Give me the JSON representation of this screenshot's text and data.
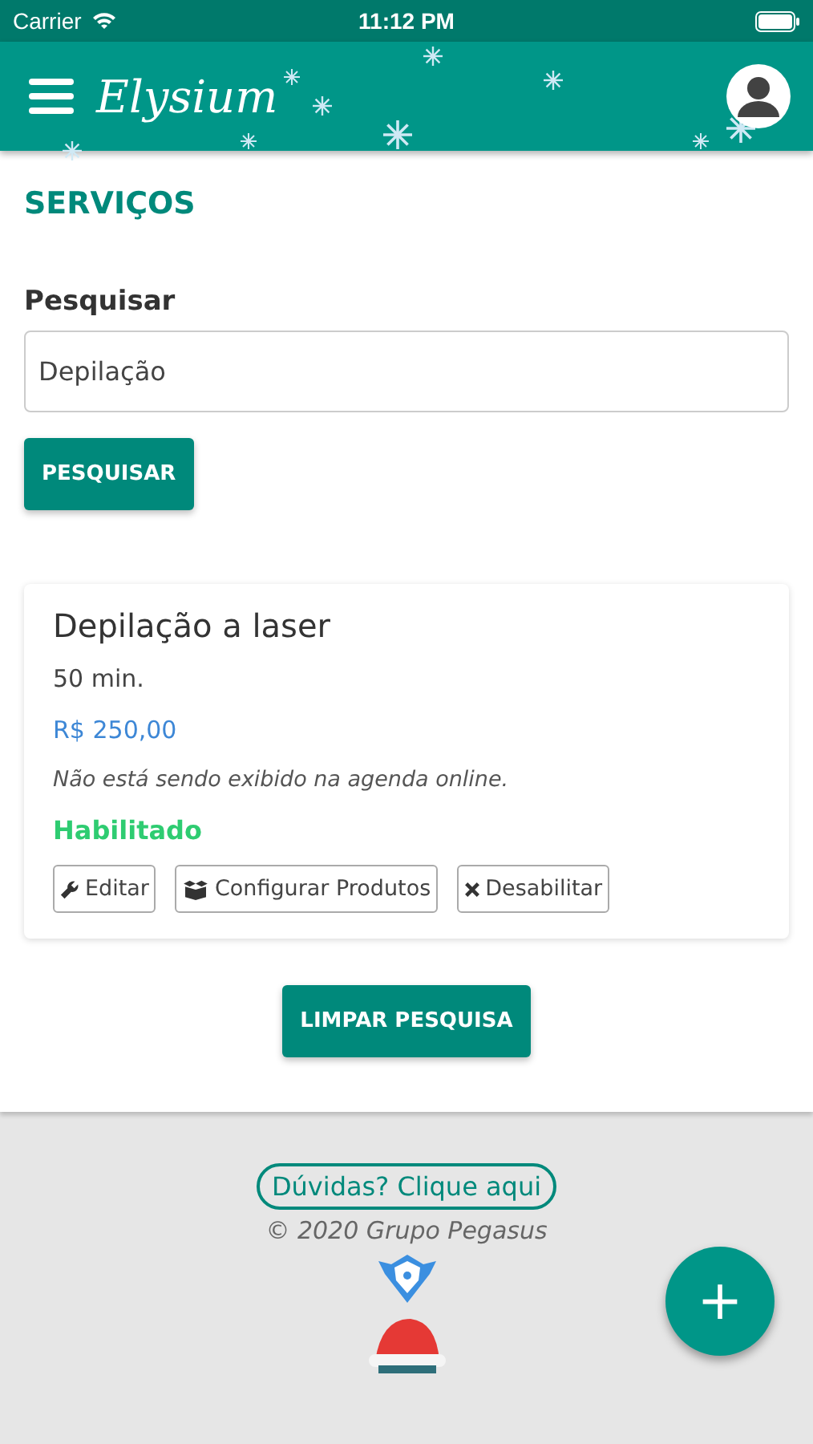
{
  "status_bar": {
    "carrier": "Carrier",
    "time": "11:12 PM"
  },
  "app_bar": {
    "title": "Elysium"
  },
  "page_title": "SERVIÇOS",
  "search": {
    "label": "Pesquisar",
    "value": "Depilação",
    "button": "PESQUISAR"
  },
  "service": {
    "name": "Depilação a laser",
    "duration": "50 min.",
    "price": "R$ 250,00",
    "note": "Não está sendo exibido na agenda online.",
    "status": "Habilitado",
    "enabled": true,
    "actions": [
      {
        "kind": "edit",
        "label": "Editar"
      },
      {
        "kind": "products",
        "label": "Configurar Produtos"
      },
      {
        "kind": "disable",
        "label": "Desabilitar"
      }
    ]
  },
  "clear_button": "LIMPAR PESQUISA",
  "footer": {
    "help_link": "Dúvidas? Clique aqui",
    "copyright": "© 2020 Grupo Pegasus"
  },
  "fab": "+"
}
